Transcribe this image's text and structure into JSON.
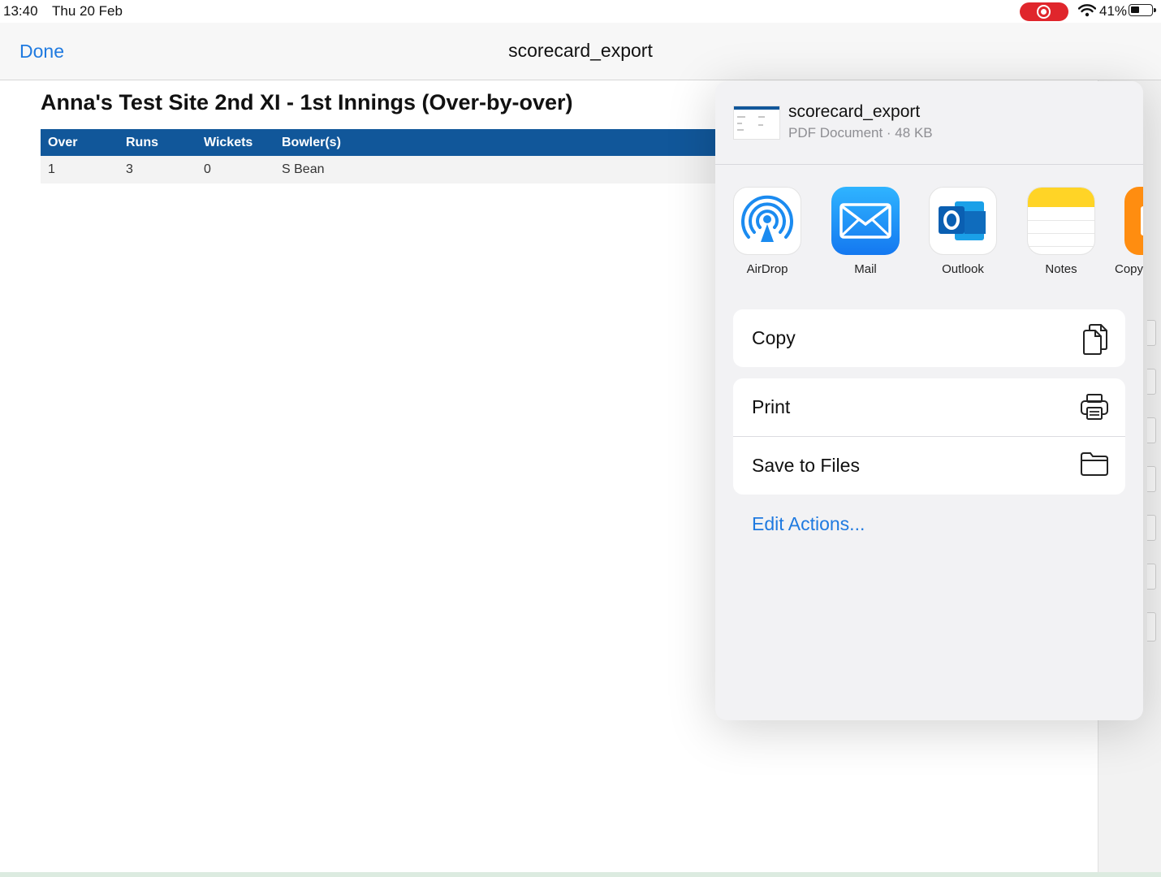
{
  "status_bar": {
    "time": "13:40",
    "date": "Thu 20 Feb",
    "battery": "41%",
    "recording_color": "#e0262c"
  },
  "nav": {
    "done_label": "Done",
    "title": "scorecard_export",
    "accent": "#1f7ae0"
  },
  "document": {
    "title": "Anna's Test Site 2nd XI - 1st Innings (Over-by-over)",
    "header_color": "#11579a",
    "columns": [
      "Over",
      "Runs",
      "Wickets",
      "Bowler(s)"
    ],
    "rows": [
      [
        "1",
        "3",
        "0",
        "S Bean"
      ]
    ]
  },
  "share_sheet": {
    "file_name": "scorecard_export",
    "file_meta": "PDF Document · 48 KB",
    "apps": [
      {
        "label": "AirDrop",
        "icon": "airdrop-icon"
      },
      {
        "label": "Mail",
        "icon": "mail-icon"
      },
      {
        "label": "Outlook",
        "icon": "outlook-icon"
      },
      {
        "label": "Notes",
        "icon": "notes-icon"
      },
      {
        "label": "Copy",
        "icon": "copy-app-icon"
      }
    ],
    "actions": [
      {
        "label": "Copy",
        "icon": "copy-icon"
      },
      {
        "label": "Print",
        "icon": "printer-icon"
      },
      {
        "label": "Save to Files",
        "icon": "folder-icon"
      }
    ],
    "edit_actions_label": "Edit Actions..."
  }
}
